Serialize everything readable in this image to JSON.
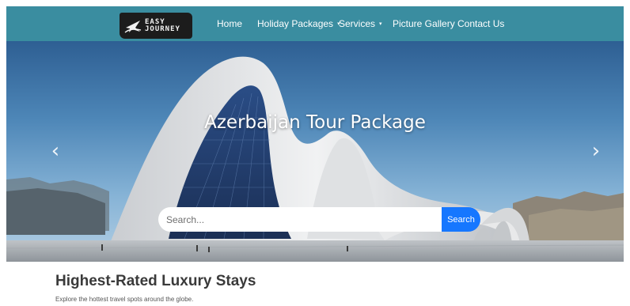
{
  "brand": {
    "logo_line1": "EASY",
    "logo_line2": "JOURNEY",
    "logo_icon": "plane-icon"
  },
  "nav": {
    "items": [
      {
        "label": "Home",
        "has_dropdown": false
      },
      {
        "label": "Holiday Packages",
        "has_dropdown": true
      },
      {
        "label": "Services",
        "has_dropdown": true
      },
      {
        "label": "Picture Gallery",
        "has_dropdown": false
      },
      {
        "label": "Contact Us",
        "has_dropdown": false
      }
    ],
    "dropdown_caret": "▾"
  },
  "hero": {
    "title": "Azerbaijan Tour Package",
    "prev_arrow": "‹",
    "next_arrow": "›",
    "search": {
      "placeholder": "Search...",
      "value": "",
      "button_label": "Search"
    }
  },
  "section": {
    "title": "Highest-Rated Luxury Stays",
    "subtitle": "Explore the hottest travel spots around the globe."
  },
  "colors": {
    "navbar": "#3a8da0",
    "search_button": "#1677ff",
    "heading": "#3a3a3a"
  }
}
